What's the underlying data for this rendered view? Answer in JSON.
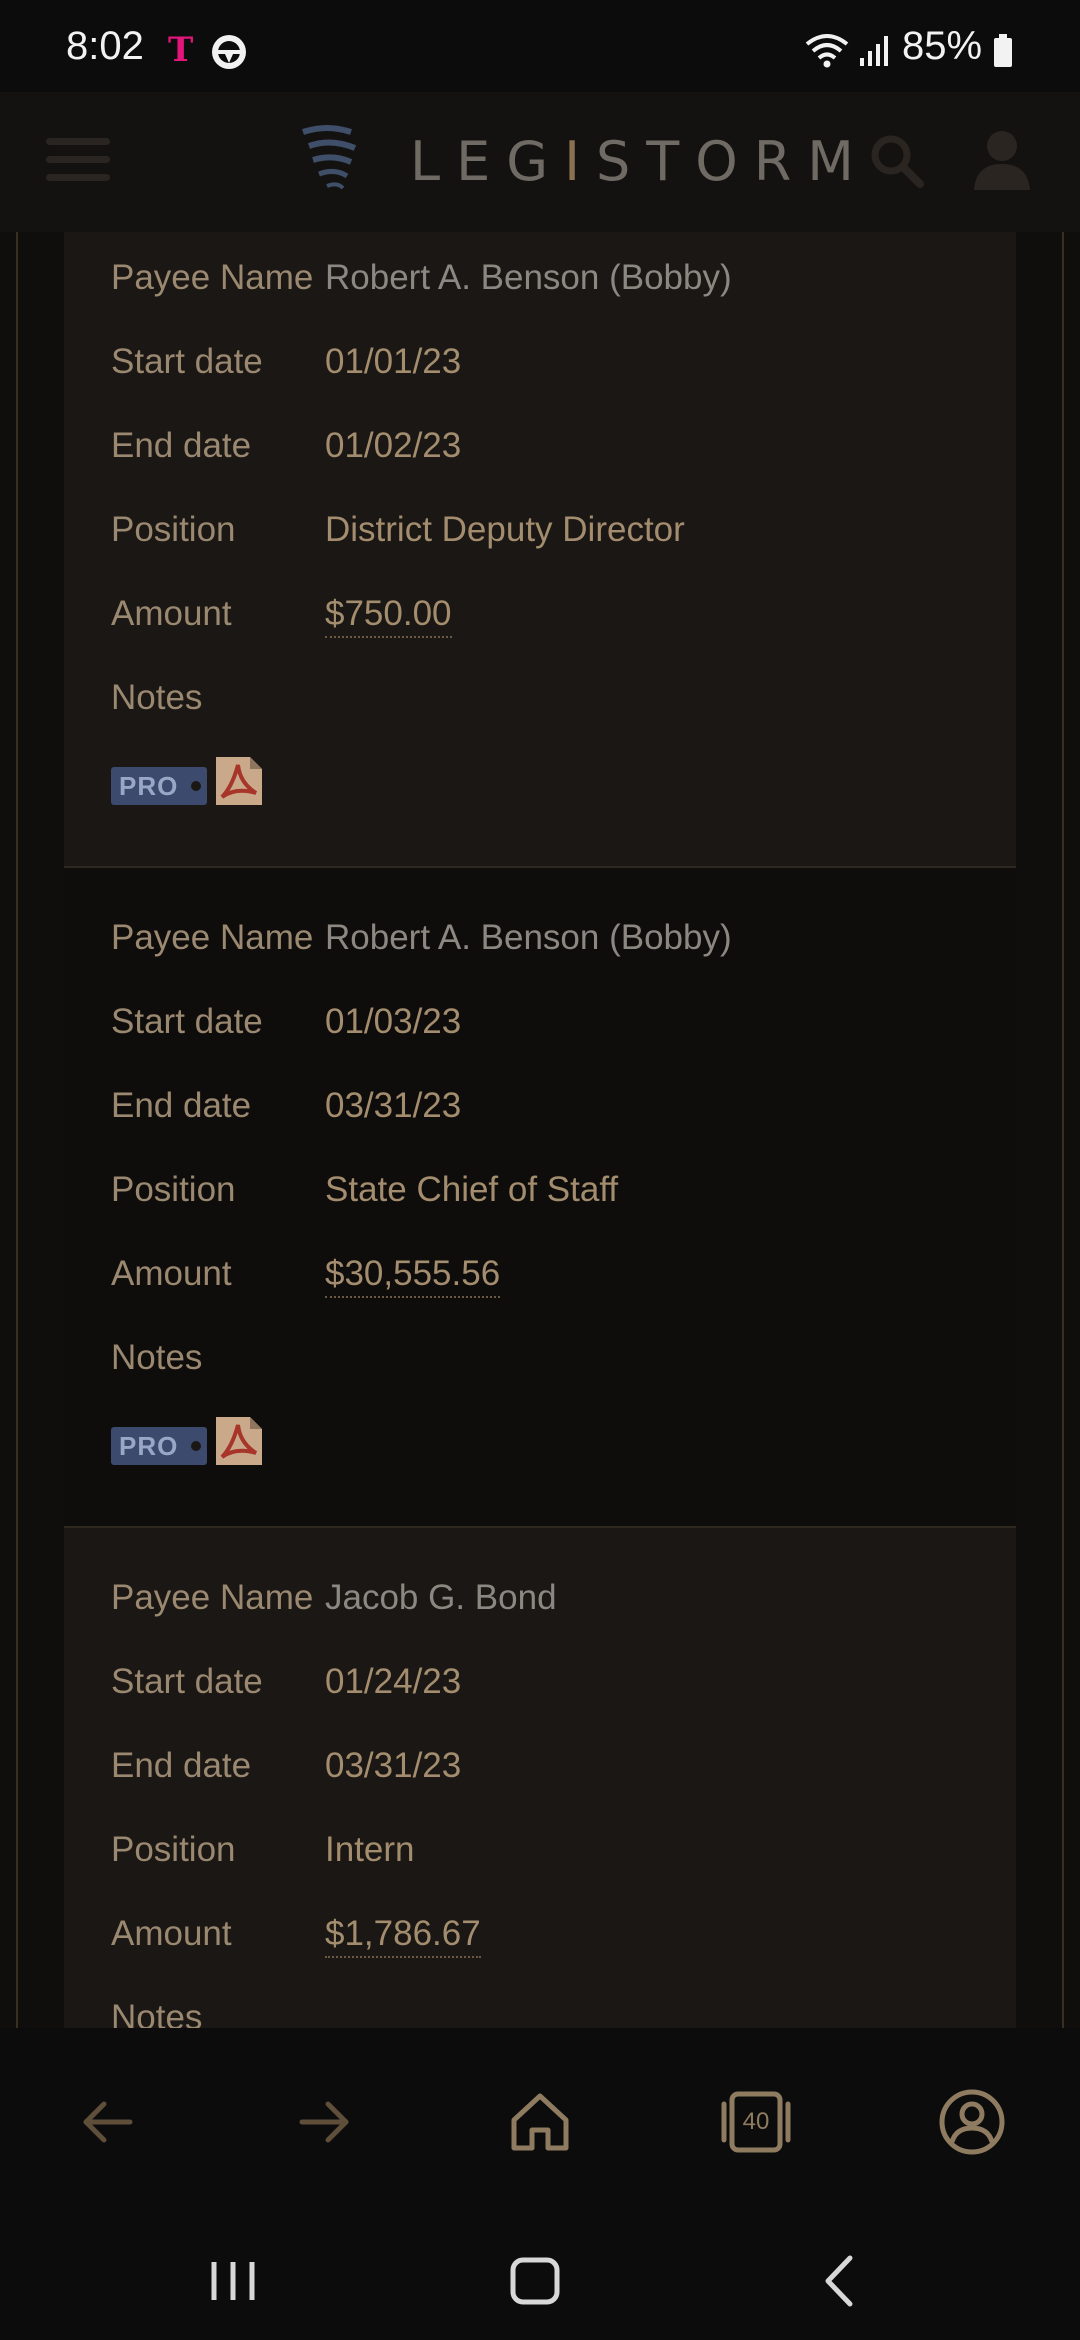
{
  "status_bar": {
    "time": "8:02",
    "carrier_icon": "T",
    "battery_text": "85%"
  },
  "header": {
    "brand": "LEGISTORM",
    "brand_accent_letter": "I"
  },
  "labels": {
    "payee_name": "Payee Name",
    "start_date": "Start date",
    "end_date": "End date",
    "position": "Position",
    "amount": "Amount",
    "notes": "Notes",
    "pro": "PRO"
  },
  "records": [
    {
      "payee_name": "Robert A. Benson (Bobby)",
      "start_date": "01/01/23",
      "end_date": "01/02/23",
      "position": "District Deputy Director",
      "amount": "$750.00",
      "notes": ""
    },
    {
      "payee_name": "Robert A. Benson (Bobby)",
      "start_date": "01/03/23",
      "end_date": "03/31/23",
      "position": "State Chief of Staff",
      "amount": "$30,555.56",
      "notes": ""
    },
    {
      "payee_name": "Jacob G. Bond",
      "start_date": "01/24/23",
      "end_date": "03/31/23",
      "position": "Intern",
      "amount": "$1,786.67",
      "notes": ""
    }
  ],
  "browser_bar": {
    "tab_count": "40"
  },
  "colors": {
    "label": "#9a8870",
    "value": "#a38d6e",
    "brand_gray": "#6f6a63",
    "brand_accent": "#8a7250",
    "pro_badge": "#3c4b6d"
  },
  "icons": [
    "carrier-t-icon",
    "navigation-app-icon",
    "wifi-icon",
    "signal-icon",
    "battery-icon",
    "menu-icon",
    "legistorm-logo-icon",
    "search-icon",
    "user-account-icon",
    "pdf-icon",
    "back-arrow-icon",
    "forward-arrow-icon",
    "home-icon",
    "tabs-icon",
    "profile-icon",
    "recents-icon",
    "home-circle-icon",
    "system-back-icon"
  ]
}
